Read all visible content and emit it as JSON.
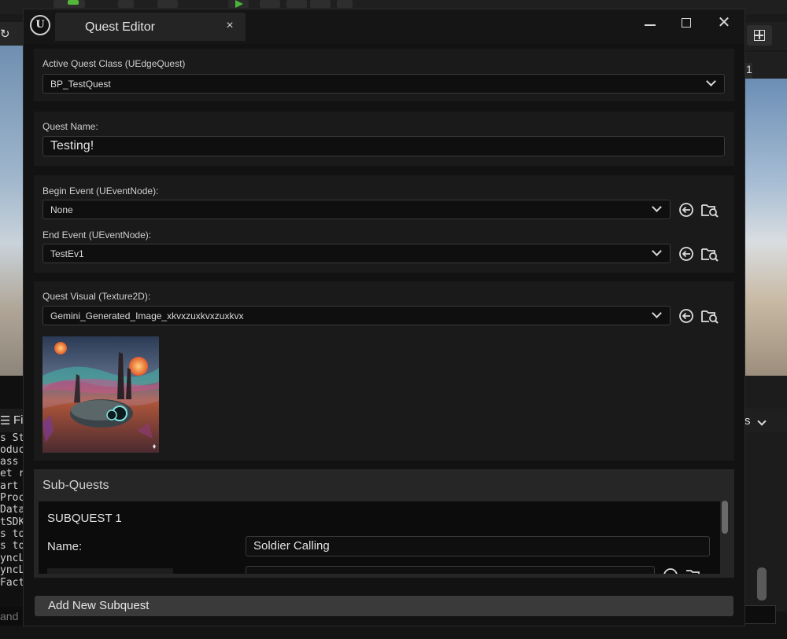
{
  "background": {
    "left_panel_header": "Fi",
    "right_panel_header": "s",
    "right_view_badge": "1",
    "log_lines": [
      "s St",
      "oduc",
      " ass",
      "et r",
      "art ",
      "Proc",
      "Data",
      "tSDK",
      "s to",
      "s to",
      "yncL",
      "yncL",
      "Fact"
    ],
    "command_placeholder": "and"
  },
  "dialog": {
    "tab_title": "Quest Editor",
    "tab_close": "×",
    "close_symbol": "✕"
  },
  "active_quest": {
    "label": "Active Quest Class (UEdgeQuest)",
    "value": "BP_TestQuest"
  },
  "quest_name": {
    "label": "Quest Name:",
    "value": "Testing!"
  },
  "events": {
    "begin_label": "Begin Event (UEventNode):",
    "begin_value": "None",
    "end_label": "End Event (UEventNode):",
    "end_value": "TestEv1"
  },
  "visual": {
    "label": "Quest Visual (Texture2D):",
    "value": "Gemini_Generated_Image_xkvxzuxkvxzuxkvx"
  },
  "subquests": {
    "title": "Sub-Quests",
    "items": [
      {
        "header": "SUBQUEST 1",
        "name_label": "Name:",
        "name_value": "Soldier Calling"
      }
    ]
  },
  "add_subquest_label": "Add New Subquest",
  "colors": {
    "panel": "#1a1a1a",
    "input_bg": "#0f0f0f",
    "dialog_bg": "#121212",
    "button_bg": "#3a3a3a"
  }
}
